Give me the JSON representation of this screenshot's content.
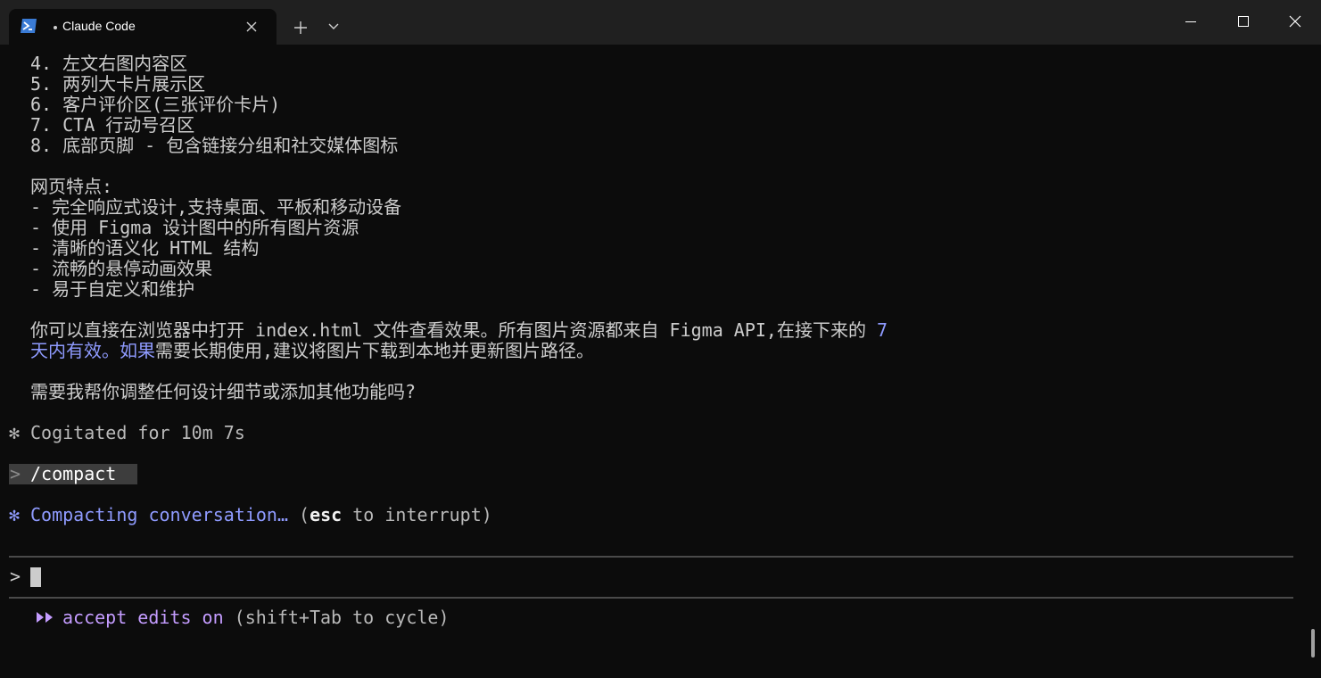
{
  "window": {
    "tab_title": "Claude Code",
    "icons": {
      "tab": "powershell-icon",
      "close_tab": "close-icon",
      "new_tab": "plus-icon",
      "dropdown": "chevron-down-icon",
      "minimize": "minimize-icon",
      "maximize": "maximize-icon",
      "close": "close-icon"
    }
  },
  "terminal": {
    "lines": [
      "4. 左文右图内容区",
      "5. 两列大卡片展示区",
      "6. 客户评价区(三张评价卡片)",
      "7. CTA 行动号召区",
      "8. 底部页脚 - 包含链接分组和社交媒体图标",
      "网页特点:",
      "- 完全响应式设计,支持桌面、平板和移动设备",
      "- 使用 Figma 设计图中的所有图片资源",
      "- 清晰的语义化 HTML 结构",
      "- 流畅的悬停动画效果",
      "- 易于自定义和维护"
    ],
    "note_line1_plain": "你可以直接在浏览器中打开 index.html 文件查看效果。所有图片资源都来自 Figma API,在接下来的 ",
    "note_line1_highlight": "7",
    "note_line2_highlight": "天内有效。如果",
    "note_line2_plain": "需要长期使用,建议将图片下载到本地并更新图片路径。",
    "question": "需要我帮你调整任何设计细节或添加其他功能吗?",
    "star_symbol": "✻",
    "cogitated": "Cogitated for 10m 7s",
    "prompt_symbol": ">",
    "command": "/compact",
    "compacting_highlight": "Compacting conversation…",
    "compacting_esc": "esc",
    "compacting_rest": " to interrupt)",
    "compacting_open": " (",
    "input_prompt": ">",
    "input_value": "",
    "mode_label": "accept edits on",
    "mode_hint": " (shift+Tab to cycle)"
  },
  "colors": {
    "background": "#0c0c0c",
    "titlebar": "#202020",
    "text": "#cccccc",
    "accent_blue": "#8f9bff",
    "accent_purple": "#c49cff"
  }
}
